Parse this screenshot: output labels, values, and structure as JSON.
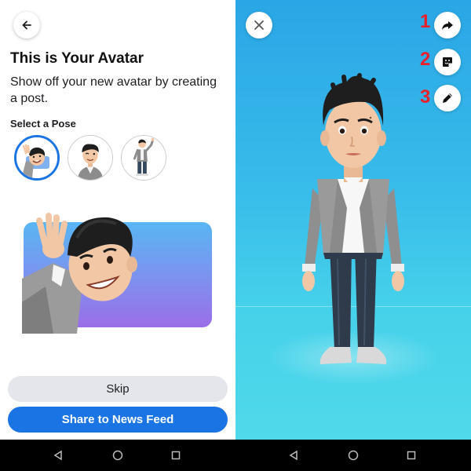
{
  "left_screen": {
    "title": "This is Your Avatar",
    "subtitle": "Show off your new avatar by creating a post.",
    "pose_section_label": "Select a Pose",
    "poses": [
      {
        "name": "peek-wave",
        "selected": true
      },
      {
        "name": "wink-portrait",
        "selected": false
      },
      {
        "name": "full-body-wave",
        "selected": false
      }
    ],
    "skip_label": "Skip",
    "share_label": "Share to News Feed"
  },
  "right_screen": {
    "actions": [
      {
        "number": "1",
        "icon": "share-arrow-icon"
      },
      {
        "number": "2",
        "icon": "sticker-icon"
      },
      {
        "number": "3",
        "icon": "pencil-edit-icon"
      }
    ]
  },
  "colors": {
    "accent": "#1b74e4",
    "annotation": "#e8202a",
    "sky_top": "#2aa6e6",
    "sky_bottom": "#50d9ea"
  }
}
